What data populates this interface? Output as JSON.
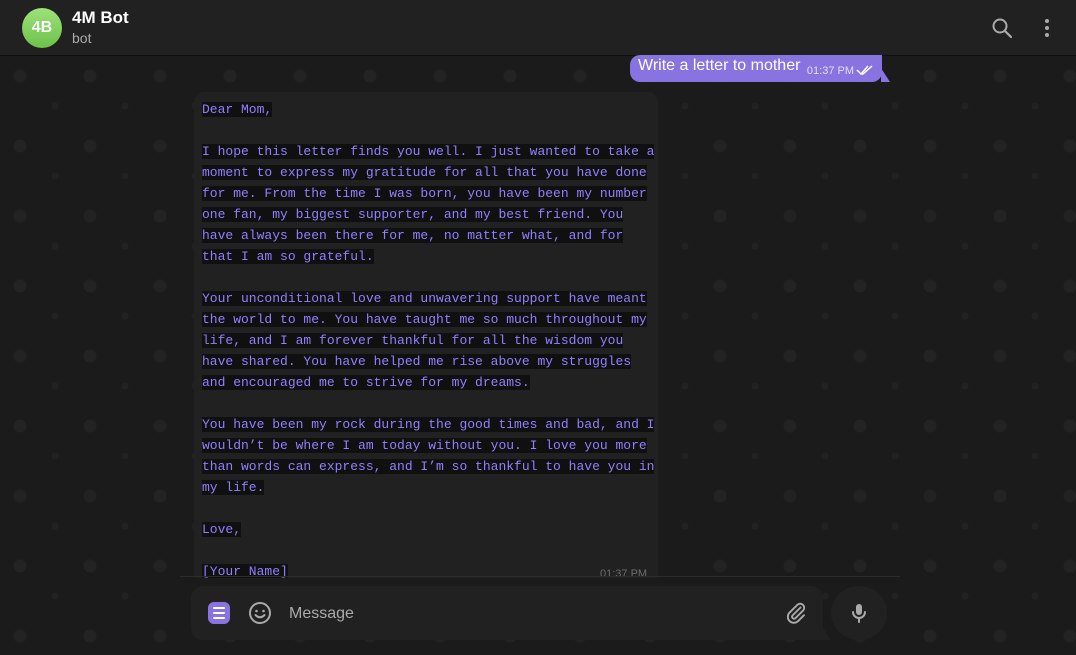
{
  "header": {
    "avatar_initials": "4B",
    "avatar_color": "#6cc24a",
    "title": "4M Bot",
    "subtitle": "bot",
    "search_icon": "search-icon",
    "more_icon": "more-vertical-icon"
  },
  "messages": {
    "outgoing": {
      "text": "Write a letter to mother",
      "time": "01:37 PM",
      "status_icon": "double-check-icon",
      "bubble_color": "#8774e1"
    },
    "incoming": {
      "lines": [
        "Dear Mom,",
        "",
        "I hope this letter finds you well. I just wanted to take a",
        "moment to express my gratitude for all that you have done",
        "for me. From the time I was born, you have been my number",
        "one fan, my biggest supporter, and my best friend. You",
        "have always been there for me, no matter what, and for",
        "that I am so grateful.",
        "",
        "Your unconditional love and unwavering support have meant",
        "the world to me. You have taught me so much throughout my",
        "life, and I am forever thankful for all the wisdom you",
        "have shared. You have helped me rise above my struggles",
        "and encouraged me to strive for my dreams.",
        "",
        "You have been my rock during the good times and bad, and I",
        "wouldn’t be where I am today without you. I love you more",
        "than words can express, and I’m so thankful to have you in",
        "my life.",
        "",
        "Love,",
        "",
        "[Your Name]"
      ],
      "time": "01:37 PM",
      "text_color": "#8f80ff"
    }
  },
  "composer": {
    "placeholder": "Message",
    "menu_icon": "bot-menu-icon",
    "emoji_icon": "emoji-icon",
    "attach_icon": "paperclip-icon",
    "mic_icon": "microphone-icon",
    "accent": "#8774e1"
  }
}
